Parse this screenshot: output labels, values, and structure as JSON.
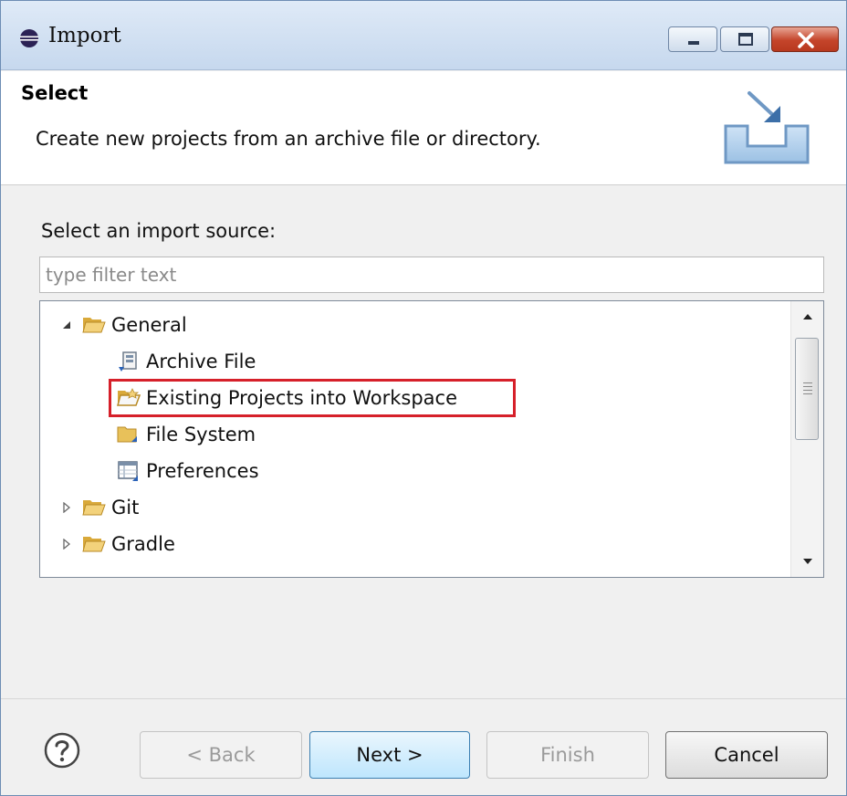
{
  "window": {
    "title": "Import"
  },
  "header": {
    "title": "Select",
    "description": "Create new projects from an archive file or directory."
  },
  "source": {
    "label": "Select an import source:",
    "filter_placeholder": "type filter text",
    "tree": [
      {
        "label": "General",
        "icon": "folder-open-icon",
        "expanded": true,
        "level": 0
      },
      {
        "label": "Archive File",
        "icon": "archive-file-icon",
        "level": 1
      },
      {
        "label": "Existing Projects into Workspace",
        "icon": "project-folder-icon",
        "level": 1,
        "selected": true
      },
      {
        "label": "File System",
        "icon": "folder-icon",
        "level": 1
      },
      {
        "label": "Preferences",
        "icon": "preferences-icon",
        "level": 1
      },
      {
        "label": "Git",
        "icon": "folder-open-icon",
        "expanded": false,
        "level": 0
      },
      {
        "label": "Gradle",
        "icon": "folder-open-icon",
        "expanded": false,
        "level": 0
      }
    ]
  },
  "buttons": {
    "back": "< Back",
    "next": "Next >",
    "finish": "Finish",
    "cancel": "Cancel"
  },
  "colors": {
    "selection_outline": "#d6202a",
    "folder": "#e8c15a"
  }
}
